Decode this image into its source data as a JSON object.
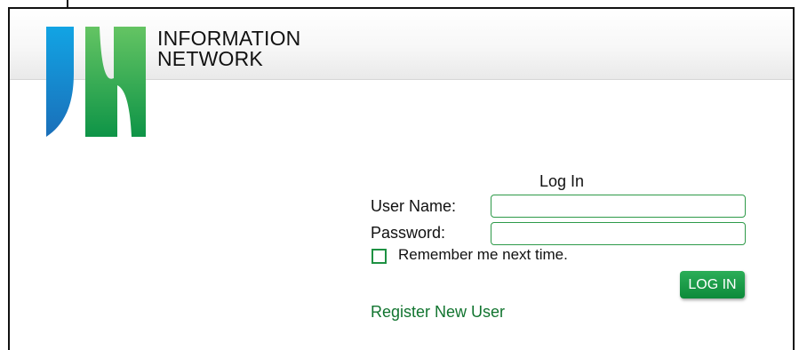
{
  "brand": {
    "line1": "INFORMATION",
    "line2": "NETWORK"
  },
  "colors": {
    "logo_blue_top": "#12a4e4",
    "logo_blue_bottom": "#1a6fb9",
    "logo_green_top": "#64c463",
    "logo_green_bottom": "#0e9447",
    "accent_green": "#1e9142",
    "link_green": "#11742f"
  },
  "login": {
    "title": "Log In",
    "username_label": "User Name:",
    "username_value": "",
    "password_label": "Password:",
    "password_value": "",
    "remember_label": "Remember me next time.",
    "submit_label": "LOG IN",
    "register_link": "Register New User"
  }
}
